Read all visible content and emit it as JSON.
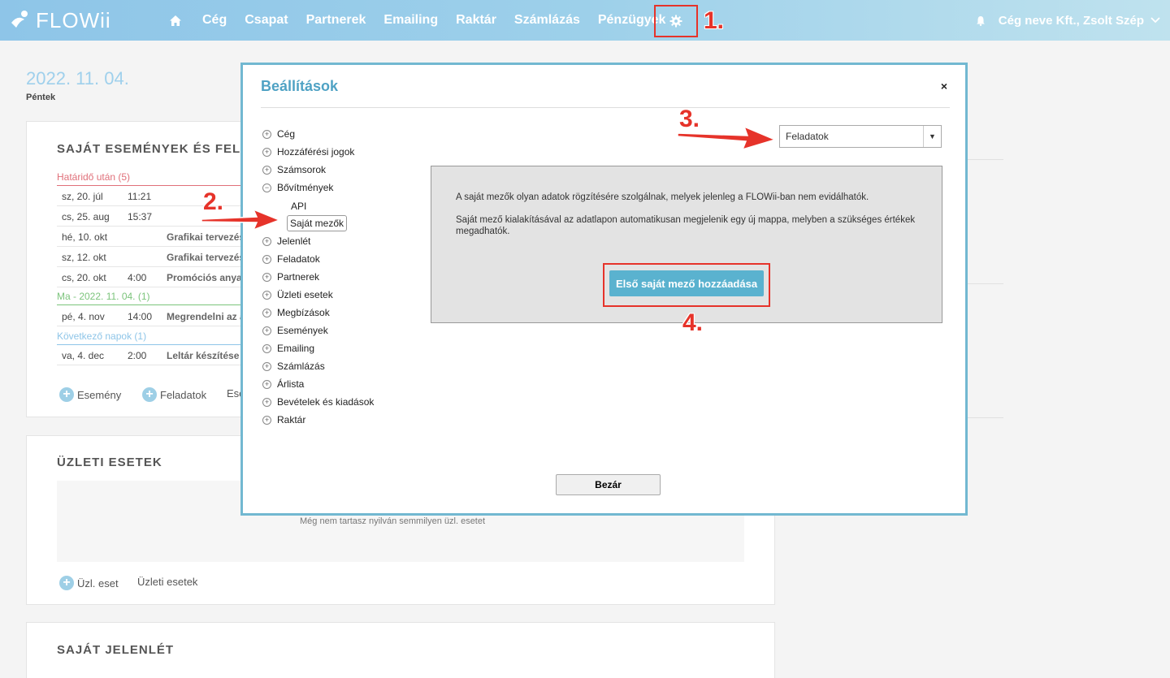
{
  "app": {
    "logo": "FLOWii"
  },
  "nav": {
    "items": [
      "Cég",
      "Csapat",
      "Partnerek",
      "Emailing",
      "Raktár",
      "Számlázás",
      "Pénzügyek"
    ],
    "user": "Cég neve Kft., Zsolt Szép"
  },
  "steps": {
    "s1": "1.",
    "s2": "2.",
    "s3": "3.",
    "s4": "4."
  },
  "dashboard": {
    "date": "2022. 11. 04.",
    "day": "Péntek",
    "events_title": "SAJÁT ESEMÉNYEK ÉS FELA",
    "groups": {
      "overdue": "Határidő után (5)",
      "today": "Ma - 2022. 11. 04. (1)",
      "next": "Következő napok (1)"
    },
    "rows": [
      {
        "date": "sz, 20. júl",
        "time": "11:21",
        "title": ""
      },
      {
        "date": "cs, 25. aug",
        "time": "15:37",
        "title": ""
      },
      {
        "date": "hé, 10. okt",
        "time": "",
        "title": "Grafikai tervezés"
      },
      {
        "date": "sz, 12. okt",
        "time": "",
        "title": "Grafikai tervezés"
      },
      {
        "date": "cs, 20. okt",
        "time": "4:00",
        "title": "Promóciós anyag"
      },
      {
        "date": "pé, 4. nov",
        "time": "14:00",
        "title": "Megrendelni az a"
      },
      {
        "date": "va, 4. dec",
        "time": "2:00",
        "title": "Leltár készítése"
      }
    ],
    "event_links": {
      "event": "Esemény",
      "tasks": "Feladatok",
      "more": "Ese"
    },
    "cases_title": "ÜZLETI ESETEK",
    "cases_empty": "Még nem tartasz nyilván semmilyen üzl. esetet",
    "cases_links": {
      "add": "Üzl. eset",
      "list": "Üzleti esetek"
    },
    "presence_title": "SAJÁT JELENLÉT"
  },
  "modal": {
    "title": "Beállítások",
    "close_x": "×",
    "tree_before": [
      "Cég",
      "Hozzáférési jogok",
      "Számsorok"
    ],
    "tree_open": "Bővítmények",
    "tree_children": [
      "API",
      "Saját mezők"
    ],
    "tree_after": [
      "Jelenlét",
      "Feladatok",
      "Partnerek",
      "Üzleti esetek",
      "Megbízások",
      "Események",
      "Emailing",
      "Számlázás",
      "Árlista",
      "Bevételek és kiadások",
      "Raktár"
    ],
    "select_value": "Feladatok",
    "info_p1": "A saját mezők olyan adatok rögzítésére szolgálnak, melyek jelenleg a FLOWii-ban nem evidálhatók.",
    "info_p2": "Saját mező kialakításával az adatlapon automatikusan megjelenik egy új mappa, melyben a szükséges értékek megadhatók.",
    "add_button": "Első saját mező hozzáadása",
    "close_button": "Bezár"
  },
  "colors": {
    "accent": "#5ab2cf",
    "highlight": "#e6332a",
    "overdue": "#e0707a",
    "today": "#7cc47c",
    "next": "#8ec5e8"
  }
}
